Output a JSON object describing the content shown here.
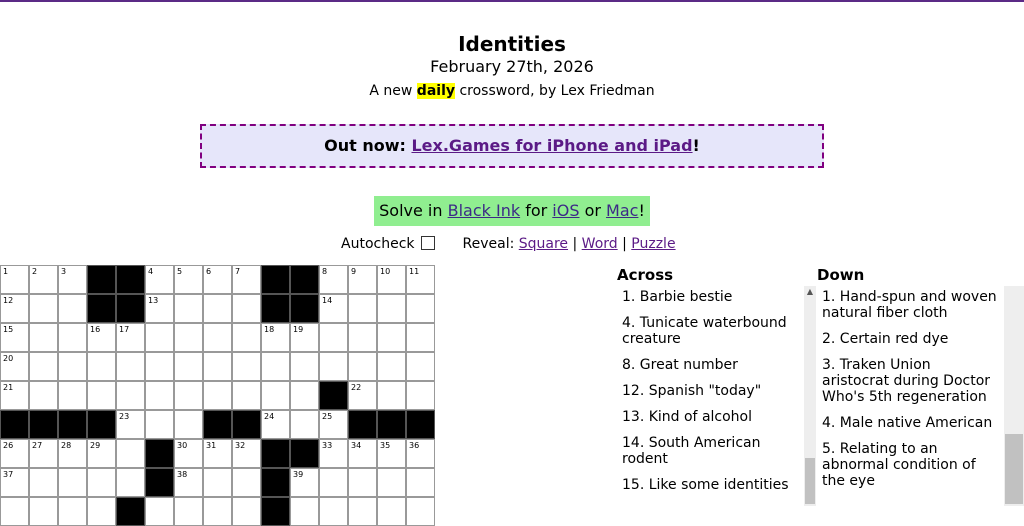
{
  "header": {
    "title": "Identities",
    "date": "February 27th, 2026",
    "byline_pre": "A new ",
    "byline_hl": "daily",
    "byline_post": " crossword, by Lex Friedman"
  },
  "promo": {
    "label": "Out now: ",
    "link": "Lex.Games for iPhone and iPad",
    "suffix": "!"
  },
  "solve": {
    "pre": "Solve in ",
    "app_link": "Black Ink",
    "for": " for ",
    "ios_link": "iOS",
    "or": " or ",
    "mac_link": "Mac",
    "suffix": "!"
  },
  "controls": {
    "autocheck_label": "Autocheck",
    "reveal_label": "Reveal:",
    "reveal_square": "Square",
    "sep1": " | ",
    "reveal_word": "Word",
    "sep2": " | ",
    "reveal_puzzle": "Puzzle"
  },
  "grid": {
    "rows": [
      [
        "1",
        "2",
        "3",
        "#",
        "#",
        "4",
        "5",
        "6",
        "7",
        "#",
        "#",
        "8",
        "9",
        "10",
        "11"
      ],
      [
        "12",
        "",
        "",
        "#",
        "#",
        "13",
        "",
        "",
        "",
        "#",
        "#",
        "14",
        "",
        "",
        ""
      ],
      [
        "15",
        "",
        "",
        "16",
        "17",
        "",
        "",
        "",
        "",
        "18",
        "19",
        "",
        "",
        "",
        ""
      ],
      [
        "20",
        "",
        "",
        "",
        "",
        "",
        "",
        "",
        "",
        "",
        "",
        "",
        "",
        "",
        ""
      ],
      [
        "21",
        "",
        "",
        "",
        "",
        "",
        "",
        "",
        "",
        "",
        "",
        "#",
        "22",
        "",
        ""
      ],
      [
        "#",
        "#",
        "#",
        "#",
        "23",
        "",
        "",
        "#",
        "#",
        "24",
        "",
        "25",
        "#",
        "#",
        "#"
      ],
      [
        "26",
        "27",
        "28",
        "29",
        "",
        "#",
        "30",
        "31",
        "32",
        "#",
        "#",
        "33",
        "34",
        "35",
        "36"
      ],
      [
        "37",
        "",
        "",
        "",
        "",
        "#",
        "38",
        "",
        "",
        "#",
        "39",
        "",
        "",
        "",
        ""
      ],
      [
        "",
        "",
        "",
        "",
        "#",
        "",
        "",
        "",
        "",
        "#",
        "",
        "",
        "",
        "",
        ""
      ]
    ]
  },
  "across": {
    "heading": "Across",
    "clues": [
      "1. Barbie bestie",
      "4. Tunicate waterbound creature",
      "8. Great number",
      "12. Spanish \"today\"",
      "13. Kind of alcohol",
      "14. South American rodent",
      "15. Like some identities"
    ]
  },
  "down": {
    "heading": "Down",
    "clues": [
      "1. Hand-spun and woven natural fiber cloth",
      "2. Certain red dye",
      "3. Traken Union aristocrat during Doctor Who's 5th regeneration",
      "4. Male native American",
      "5. Relating to an abnormal condition of the eye"
    ]
  },
  "colors": {
    "accent": "#5b2a86",
    "promo_bg": "#e6e6fa",
    "promo_border": "#800080",
    "solve_bg": "#90ee90",
    "highlight": "#ffff00"
  }
}
